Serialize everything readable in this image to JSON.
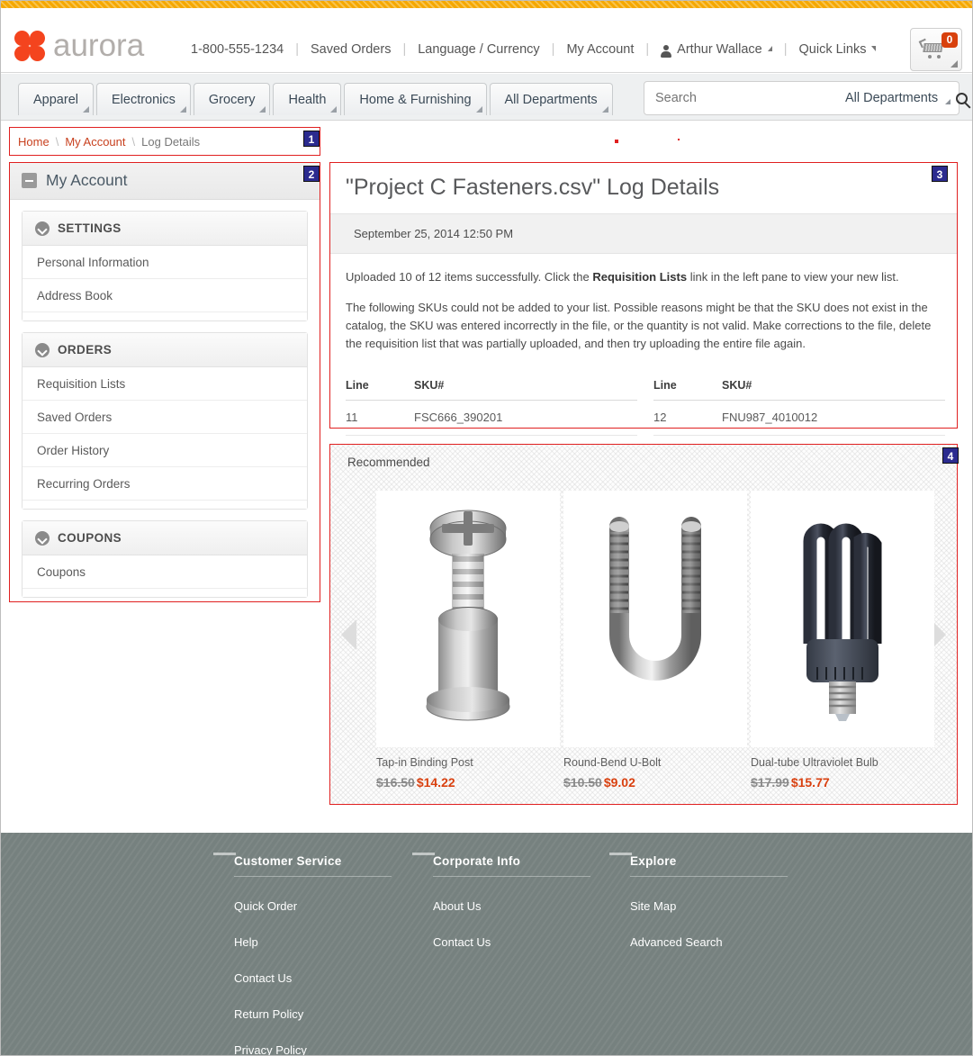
{
  "header": {
    "brand": "aurora",
    "phone": "1-800-555-1234",
    "links": [
      "Saved Orders",
      "Language / Currency",
      "My Account"
    ],
    "user_name": "Arthur Wallace",
    "quick_links": "Quick Links",
    "cart_count": "0"
  },
  "nav": {
    "tabs": [
      "Apparel",
      "Electronics",
      "Grocery",
      "Health",
      "Home & Furnishing",
      "All Departments"
    ],
    "search_placeholder": "Search",
    "search_value": "",
    "search_scope": "All Departments"
  },
  "breadcrumb": {
    "home": "Home",
    "my_account": "My Account",
    "current": "Log Details"
  },
  "sidebar": {
    "title": "My Account",
    "groups": [
      {
        "title": "SETTINGS",
        "items": [
          "Personal Information",
          "Address Book"
        ]
      },
      {
        "title": "ORDERS",
        "items": [
          "Requisition Lists",
          "Saved Orders",
          "Order History",
          "Recurring Orders"
        ]
      },
      {
        "title": "COUPONS",
        "items": [
          "Coupons"
        ]
      }
    ]
  },
  "log": {
    "title": "\"Project C Fasteners.csv\" Log Details",
    "date": "September 25, 2014 12:50 PM",
    "para1_before": "Uploaded 10 of 12 items successfully. Click the ",
    "para1_bold": "Requisition Lists",
    "para1_after": " link in the left pane to view your new list.",
    "para2": "The following SKUs could not be added to your list. Possible reasons might be that the SKU does not exist in the catalog, the SKU was entered incorrectly in the file, or the quantity is not valid. Make corrections to the file, delete the requisition list that was partially uploaded, and then try uploading the entire file again.",
    "table_headers": [
      "Line",
      "SKU#"
    ],
    "rows_left": [
      {
        "line": "11",
        "sku": "FSC666_390201"
      }
    ],
    "rows_right": [
      {
        "line": "12",
        "sku": "FNU987_4010012"
      }
    ]
  },
  "recommended": {
    "title": "Recommended",
    "products": [
      {
        "name": "Tap-in Binding Post",
        "old_price": "$16.50",
        "new_price": "$14.22",
        "image": "screw-binding-post"
      },
      {
        "name": "Round-Bend U-Bolt",
        "old_price": "$10.50",
        "new_price": "$9.02",
        "image": "u-bolt"
      },
      {
        "name": "Dual-tube Ultraviolet Bulb",
        "old_price": "$17.99",
        "new_price": "$15.77",
        "image": "cfl-bulb"
      }
    ]
  },
  "footer": {
    "columns": [
      {
        "heading": "Customer Service",
        "links": [
          "Quick Order",
          "Help",
          "Contact Us",
          "Return Policy",
          "Privacy Policy"
        ]
      },
      {
        "heading": "Corporate Info",
        "links": [
          "About Us",
          "Contact Us"
        ]
      },
      {
        "heading": "Explore",
        "links": [
          "Site Map",
          "Advanced Search"
        ]
      }
    ]
  },
  "annotations": {
    "badges": [
      "1",
      "2",
      "3",
      "4"
    ]
  },
  "colors": {
    "accent_orange": "#f4441e",
    "top_bar": "#f5a800",
    "price_sale": "#d9400f",
    "footer_bg": "#76817f"
  }
}
